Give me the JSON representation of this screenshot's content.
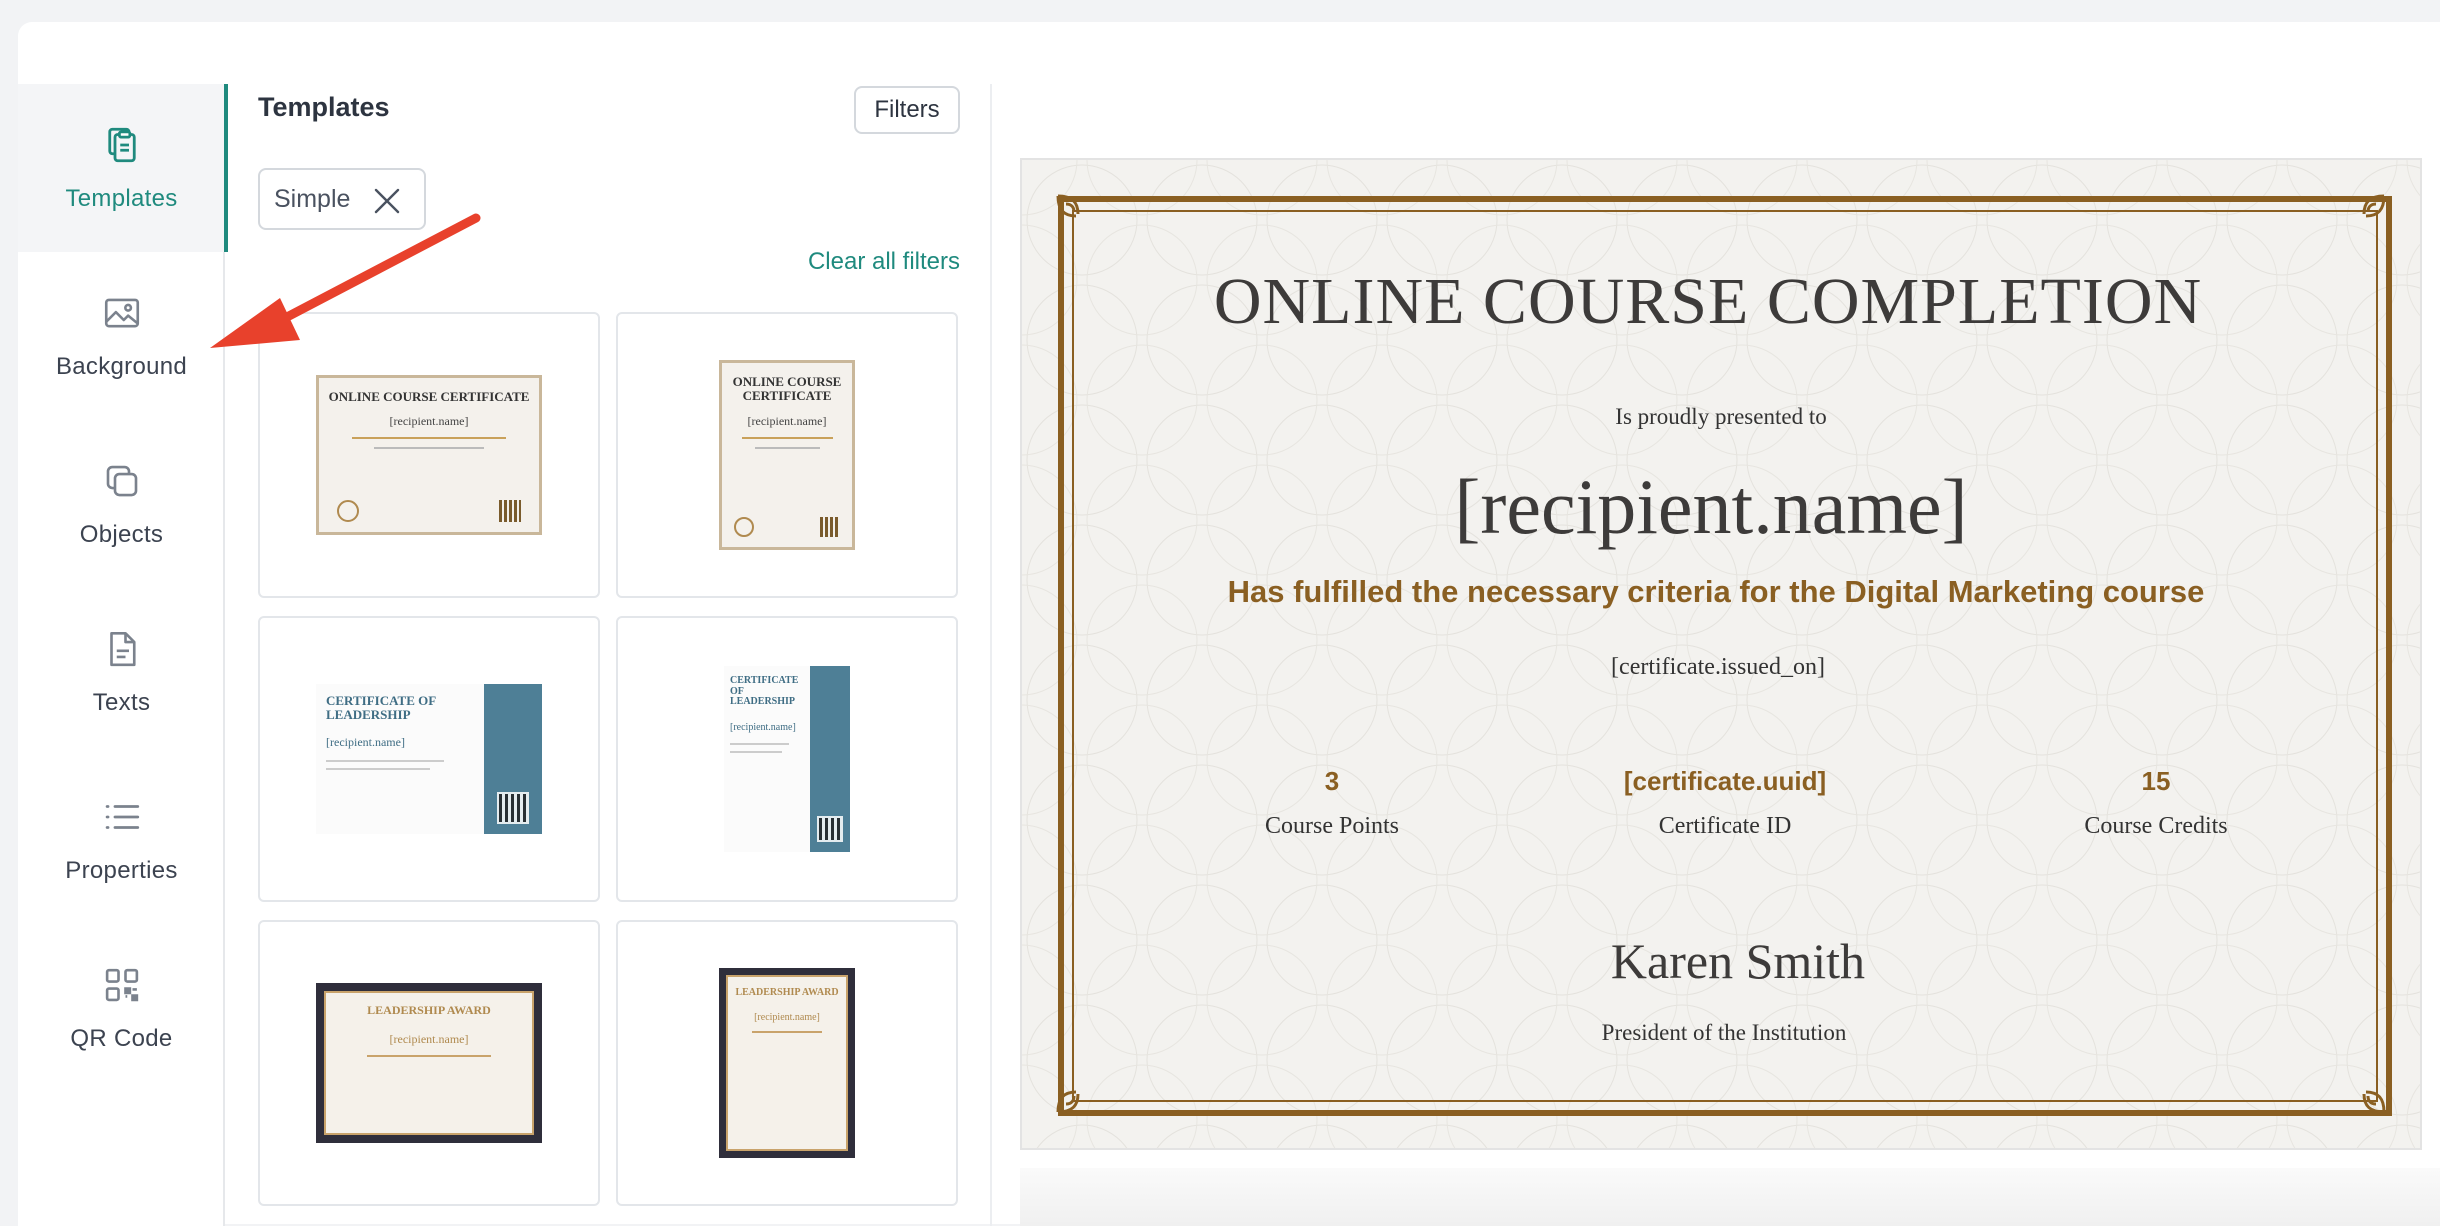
{
  "sidebar": {
    "items": [
      {
        "label": "Templates",
        "icon": "clipboard-copy-icon",
        "active": true
      },
      {
        "label": "Background",
        "icon": "image-icon"
      },
      {
        "label": "Objects",
        "icon": "objects-icon"
      },
      {
        "label": "Texts",
        "icon": "text-file-icon"
      },
      {
        "label": "Properties",
        "icon": "list-icon"
      },
      {
        "label": "QR Code",
        "icon": "qr-code-icon"
      }
    ]
  },
  "panel": {
    "title": "Templates",
    "filters_label": "Filters",
    "active_filter": "Simple",
    "clear_label": "Clear all filters",
    "thumbnails": [
      {
        "title": "ONLINE COURSE CERTIFICATE",
        "name": "[recipient.name]"
      },
      {
        "title": "ONLINE COURSE CERTIFICATE",
        "name": "[recipient.name]"
      },
      {
        "title": "CERTIFICATE OF LEADERSHIP",
        "name": "[recipient.name]"
      },
      {
        "title": "CERTIFICATE OF LEADERSHIP",
        "name": "[recipient.name]"
      },
      {
        "title": "LEADERSHIP AWARD",
        "name": "[recipient.name]"
      },
      {
        "title": "LEADERSHIP AWARD",
        "name": "[recipient.name]"
      }
    ]
  },
  "certificate": {
    "title": "ONLINE COURSE COMPLETION",
    "presented": "Is proudly presented to",
    "recipient": "[recipient.name]",
    "criteria": "Has fulfilled the necessary criteria for the Digital Marketing course",
    "issued": "[certificate.issued_on]",
    "stats": [
      {
        "value": "3",
        "label": "Course Points"
      },
      {
        "value": "[certificate.uuid]",
        "label": "Certificate ID"
      },
      {
        "value": "15",
        "label": "Course Credits"
      }
    ],
    "signer": "Karen Smith",
    "signer_role": "President of the Institution"
  },
  "colors": {
    "accent": "#1f8a7e",
    "gold": "#8a5f22",
    "band_blue": "#4e7f96",
    "arrow_red": "#e8412c"
  }
}
